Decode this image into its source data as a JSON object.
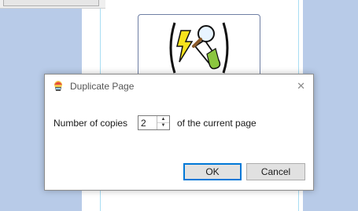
{
  "dialog": {
    "title": "Duplicate Page",
    "close_symbol": "✕",
    "copies_label": "Number of copies",
    "copies_value": "2",
    "suffix_label": "of the current page",
    "ok_label": "OK",
    "cancel_label": "Cancel"
  },
  "icons": {
    "title_icon": "app-icon",
    "close_icon": "close-icon",
    "spin_up": "▲",
    "spin_down": "▼",
    "symbol_card": "science-symbol-icon"
  },
  "colors": {
    "workspace": "#b8cbe8",
    "accent": "#0078d7",
    "guide": "#a9ddf3"
  }
}
